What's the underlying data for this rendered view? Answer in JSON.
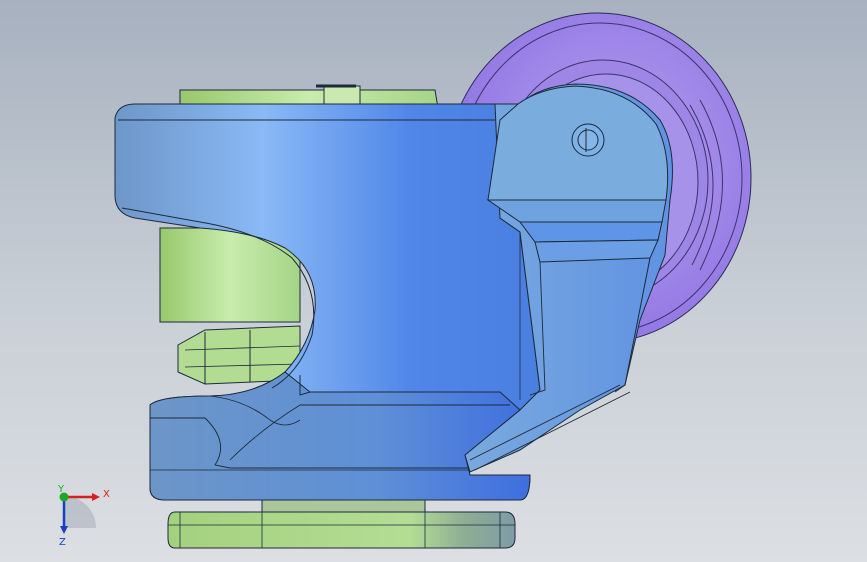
{
  "viewport": {
    "background_top": "#a7b1bf",
    "background_bottom": "#dcdfe3"
  },
  "model": {
    "body_color": "#6f9fdc",
    "base_color": "#a9d48a",
    "wheel_color": "#a48ae8",
    "edge_color": "#1c2a3a"
  },
  "triad": {
    "x_label": "X",
    "y_label": "Y",
    "z_label": "Z",
    "x_color": "#d42020",
    "y_color": "#1ea82a",
    "z_color": "#1a3dc8"
  }
}
